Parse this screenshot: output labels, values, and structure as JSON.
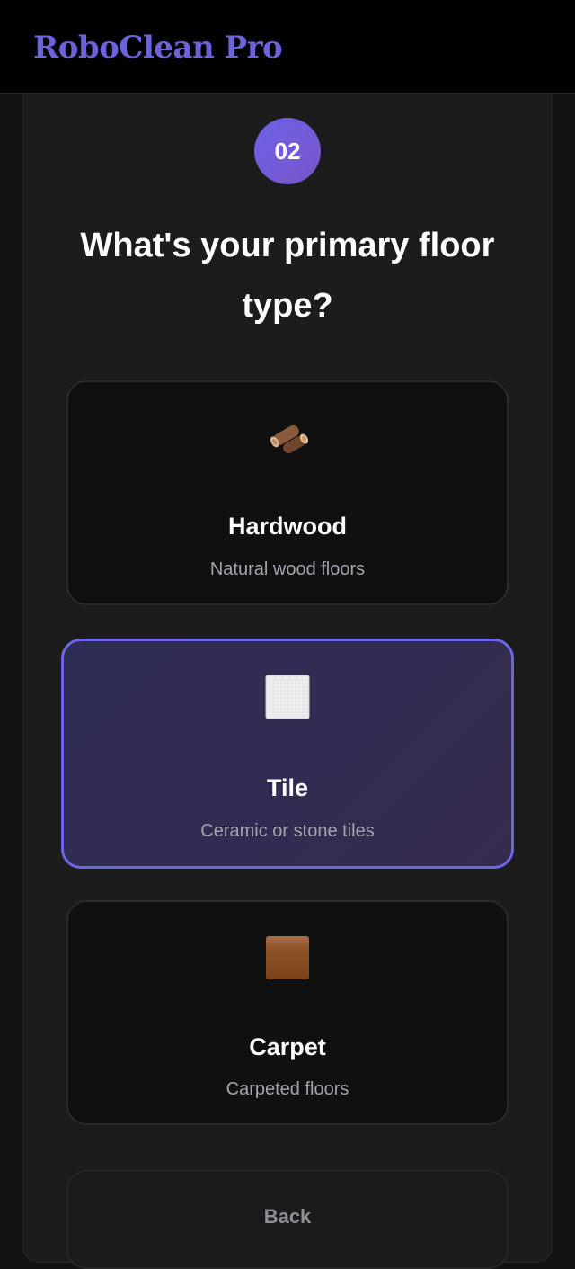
{
  "app": {
    "brand": "RoboClean Pro"
  },
  "step": {
    "number": "02"
  },
  "question": "What's your primary floor type?",
  "options": [
    {
      "title": "Hardwood",
      "description": "Natural wood floors",
      "icon": "wood-log-icon",
      "selected": false
    },
    {
      "title": "Tile",
      "description": "Ceramic or stone tiles",
      "icon": "tile-square-icon",
      "selected": true
    },
    {
      "title": "Carpet",
      "description": "Carpeted floors",
      "icon": "carpet-square-icon",
      "selected": false
    }
  ],
  "nav": {
    "back_label": "Back"
  },
  "colors": {
    "accent": "#6b63e8",
    "selected_border": "#6b66e6",
    "background": "#121212"
  }
}
